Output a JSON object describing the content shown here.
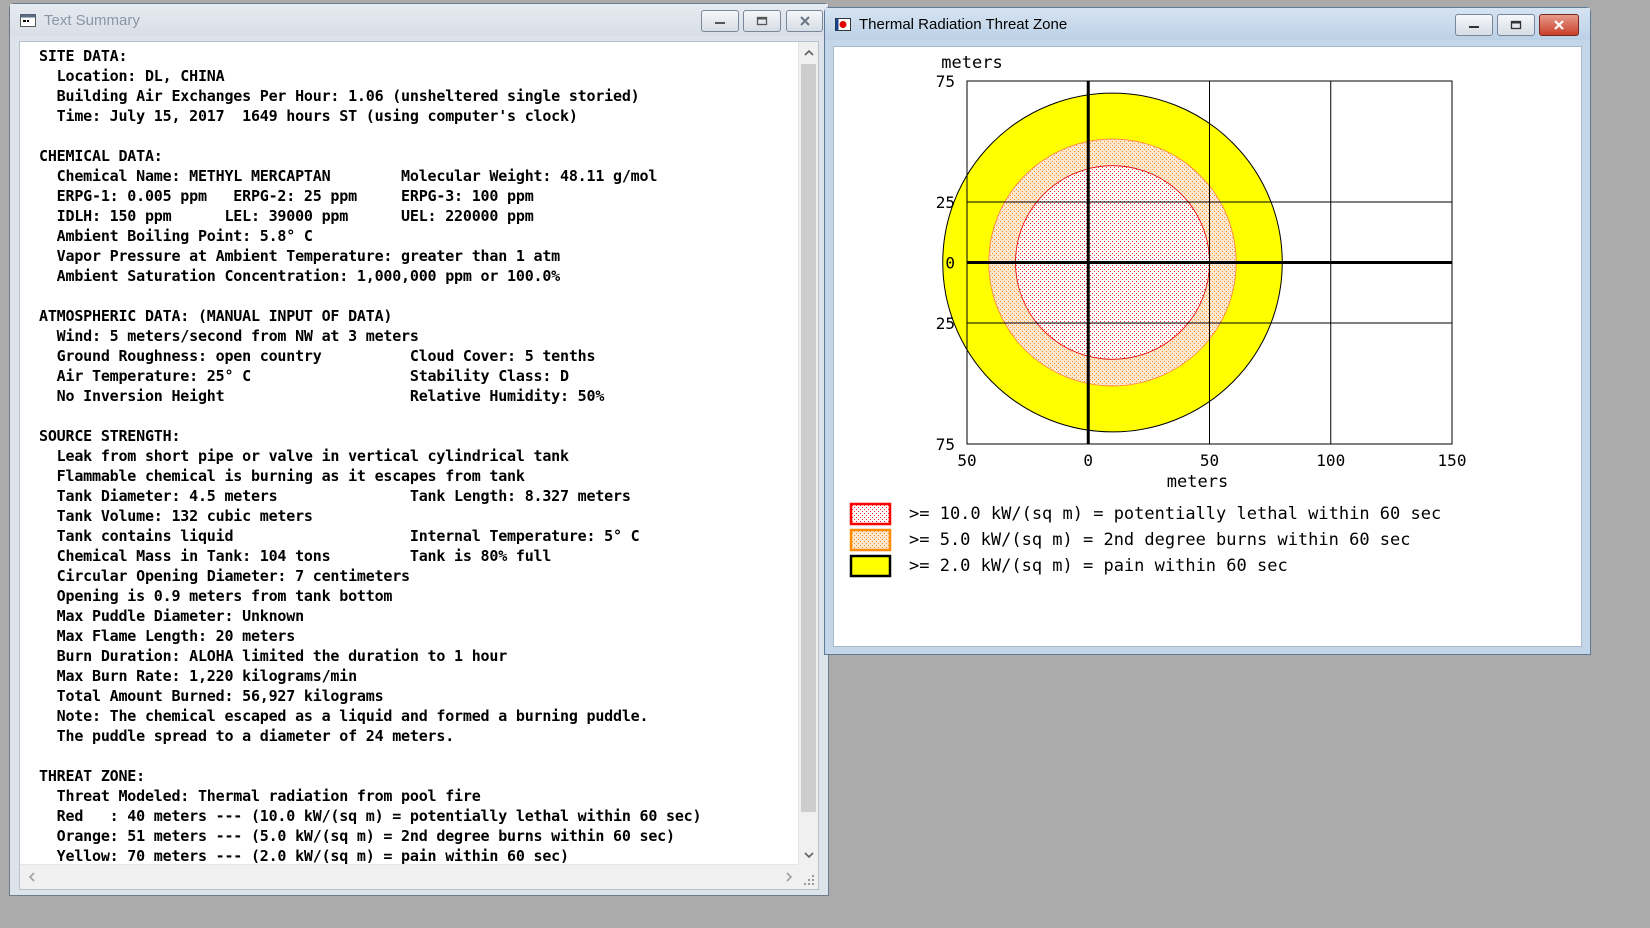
{
  "text_window": {
    "title": "Text Summary",
    "lines": [
      "SITE DATA:",
      "  Location: DL, CHINA",
      "  Building Air Exchanges Per Hour: 1.06 (unsheltered single storied)",
      "  Time: July 15, 2017  1649 hours ST (using computer's clock)",
      "",
      "CHEMICAL DATA:",
      "  Chemical Name: METHYL MERCAPTAN        Molecular Weight: 48.11 g/mol",
      "  ERPG-1: 0.005 ppm   ERPG-2: 25 ppm     ERPG-3: 100 ppm",
      "  IDLH: 150 ppm      LEL: 39000 ppm      UEL: 220000 ppm",
      "  Ambient Boiling Point: 5.8° C",
      "  Vapor Pressure at Ambient Temperature: greater than 1 atm",
      "  Ambient Saturation Concentration: 1,000,000 ppm or 100.0%",
      "",
      "ATMOSPHERIC DATA: (MANUAL INPUT OF DATA)",
      "  Wind: 5 meters/second from NW at 3 meters",
      "  Ground Roughness: open country          Cloud Cover: 5 tenths",
      "  Air Temperature: 25° C                  Stability Class: D",
      "  No Inversion Height                     Relative Humidity: 50%",
      "",
      "SOURCE STRENGTH:",
      "  Leak from short pipe or valve in vertical cylindrical tank",
      "  Flammable chemical is burning as it escapes from tank",
      "  Tank Diameter: 4.5 meters               Tank Length: 8.327 meters",
      "  Tank Volume: 132 cubic meters",
      "  Tank contains liquid                    Internal Temperature: 5° C",
      "  Chemical Mass in Tank: 104 tons         Tank is 80% full",
      "  Circular Opening Diameter: 7 centimeters",
      "  Opening is 0.9 meters from tank bottom",
      "  Max Puddle Diameter: Unknown",
      "  Max Flame Length: 20 meters",
      "  Burn Duration: ALOHA limited the duration to 1 hour",
      "  Max Burn Rate: 1,220 kilograms/min",
      "  Total Amount Burned: 56,927 kilograms",
      "  Note: The chemical escaped as a liquid and formed a burning puddle.",
      "  The puddle spread to a diameter of 24 meters.",
      "",
      "THREAT ZONE:",
      "  Threat Modeled: Thermal radiation from pool fire",
      "  Red   : 40 meters --- (10.0 kW/(sq m) = potentially lethal within 60 sec)",
      "  Orange: 51 meters --- (5.0 kW/(sq m) = 2nd degree burns within 60 sec)",
      "  Yellow: 70 meters --- (2.0 kW/(sq m) = pain within 60 sec)"
    ]
  },
  "threat_window": {
    "title": "Thermal Radiation Threat Zone"
  },
  "window_buttons": {
    "minimize_icon": "minimize-icon",
    "maximize_icon": "maximize-icon",
    "close_icon": "close-icon"
  },
  "chart_data": {
    "type": "threat-zone-plot",
    "xlabel": "meters",
    "ylabel": "meters",
    "xlim": [
      -50,
      150
    ],
    "ylim": [
      -75,
      75
    ],
    "xticks": [
      -50,
      0,
      50,
      100,
      150
    ],
    "xtick_labels": [
      "50",
      "0",
      "50",
      "100",
      "150"
    ],
    "yticks": [
      75,
      25,
      0,
      -25,
      -75
    ],
    "ytick_labels": [
      "75",
      "25",
      "0",
      "25",
      "75"
    ],
    "grid": true,
    "series": [
      {
        "name": ">= 2.0 kW/(sq m) = pain within 60 sec",
        "color": "#ffff00",
        "edge": "#000000",
        "center": [
          10,
          0
        ],
        "radius_m": 70
      },
      {
        "name": ">= 5.0 kW/(sq m) = 2nd degree burns within 60 sec",
        "color": "#ffa500",
        "edge": "#ff4500",
        "center": [
          10,
          0
        ],
        "radius_m": 51
      },
      {
        "name": ">= 10.0 kW/(sq m) = potentially lethal within 60 sec",
        "color": "#ff0000",
        "edge": "#e00000",
        "center": [
          10,
          0
        ],
        "radius_m": 40
      }
    ],
    "legend": [
      {
        "label": ">= 10.0 kW/(sq m) = potentially lethal within 60 sec",
        "fill": "#ff0000",
        "border": "#ff0000",
        "pattern": "dots"
      },
      {
        "label": ">= 5.0 kW/(sq m) = 2nd degree burns within 60 sec",
        "fill": "#ffa500",
        "border": "#ff8c00",
        "pattern": "dots"
      },
      {
        "label": ">= 2.0 kW/(sq m) = pain within 60 sec",
        "fill": "#ffff00",
        "border": "#000000",
        "pattern": "solid"
      }
    ],
    "legend_position": "bottom"
  }
}
